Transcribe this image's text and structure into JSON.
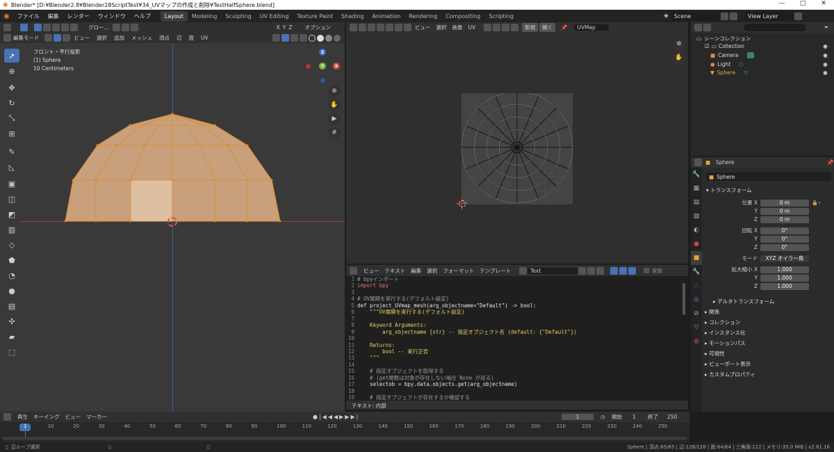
{
  "window": {
    "title": "Blender* [D:¥Blender2.8¥Blender28ScriptTest¥34_UVマップの作成と削除¥TestHalfSphere.blend]",
    "controls": [
      "—",
      "□",
      "✕"
    ]
  },
  "menu": {
    "items": [
      "ファイル",
      "編集",
      "レンダー",
      "ウィンドウ",
      "ヘルプ"
    ],
    "workspaces": [
      "Layout",
      "Modeling",
      "Sculpting",
      "UV Editing",
      "Texture Paint",
      "Shading",
      "Animation",
      "Rendering",
      "Compositing",
      "Scripting"
    ],
    "active_workspace": "Layout",
    "scene": "Scene",
    "view_layer": "View Layer"
  },
  "viewport": {
    "mode": "編集モード",
    "menus": [
      "ビュー",
      "選択",
      "追加",
      "メッシュ",
      "頂点",
      "辺",
      "面",
      "UV"
    ],
    "orientation": "グロー...",
    "options": "オプション",
    "axes": [
      "X",
      "Y",
      "Z"
    ],
    "info_line1": "フロント・平行投影",
    "info_line2": "(1) Sphere",
    "info_line3": "10 Centimeters"
  },
  "uv_editor": {
    "menus": [
      "ビュー",
      "選択",
      "画像",
      "UV"
    ],
    "new_label": "新規",
    "open_label": "開く",
    "uvmap": "UVMap"
  },
  "text_editor": {
    "menus": [
      "ビュー",
      "テキスト",
      "編集",
      "選択",
      "フォーマット",
      "テンプレート"
    ],
    "file": "Text",
    "register": "登録",
    "status": "テキスト: 内部",
    "lines": [
      {
        "n": "1",
        "t": "# bpyインポート",
        "c": "#9a9a9a"
      },
      {
        "n": "2",
        "t": "import bpy",
        "c": "#e07070"
      },
      {
        "n": "3",
        "t": "",
        "c": "#ddd"
      },
      {
        "n": "4",
        "t": "# UV展開を実行する(デフォルト設定)",
        "c": "#9a9a9a"
      },
      {
        "n": "5",
        "t": "def project_UVmap_mesh(arg_objectname=\"Default\") -> bool:",
        "c": "#e6e6e6"
      },
      {
        "n": "6",
        "t": "    \"\"\"UV展開を実行する(デフォルト設定)",
        "c": "#e8d060"
      },
      {
        "n": "7",
        "t": "",
        "c": "#ddd"
      },
      {
        "n": "8",
        "t": "    Keyword Arguments:",
        "c": "#e8d060"
      },
      {
        "n": "9",
        "t": "        arg_objectname {str} -- 指定オブジェクト名 (default: {\"Default\"})",
        "c": "#e8d060"
      },
      {
        "n": "10",
        "t": "",
        "c": "#ddd"
      },
      {
        "n": "11",
        "t": "    Returns:",
        "c": "#e8d060"
      },
      {
        "n": "12",
        "t": "        bool -- 実行正否",
        "c": "#e8d060"
      },
      {
        "n": "13",
        "t": "    \"\"\"",
        "c": "#e8d060"
      },
      {
        "n": "14",
        "t": "",
        "c": "#ddd"
      },
      {
        "n": "15",
        "t": "    # 指定オブジェクトを取得する",
        "c": "#9a9a9a"
      },
      {
        "n": "16",
        "t": "    # (get関数は対象が存在しない場合 None が返る)",
        "c": "#9a9a9a"
      },
      {
        "n": "17",
        "t": "    selectob = bpy.data.objects.get(arg_objectname)",
        "c": "#e6e6e6"
      },
      {
        "n": "18",
        "t": "",
        "c": "#ddd"
      },
      {
        "n": "19",
        "t": "    # 指定オブジェクトが存在するか確認する",
        "c": "#9a9a9a"
      }
    ]
  },
  "outliner": {
    "root": "シーンコレクション",
    "collection": "Collection",
    "items": [
      "Camera",
      "Light",
      "Sphere"
    ]
  },
  "properties": {
    "object": "Sphere",
    "object_field": "Sphere",
    "transform": "トランスフォーム",
    "location_label": "位置 X",
    "rotation_label": "回転 X",
    "scale_label": "拡大縮小 X",
    "y": "Y",
    "z": "Z",
    "loc": [
      "0 m",
      "0 m",
      "0 m"
    ],
    "rot": [
      "0°",
      "0°",
      "0°"
    ],
    "scale": [
      "1.000",
      "1.000",
      "1.000"
    ],
    "mode_label": "モード",
    "mode": "XYZ オイラー角",
    "delta": "デルタトランスフォーム",
    "sections": [
      "関係",
      "コレクション",
      "インスタンス化",
      "モーションパス",
      "可視性",
      "ビューポート表示",
      "カスタムプロパティ"
    ]
  },
  "timeline": {
    "menus": [
      "再生",
      "キーイング",
      "ビュー",
      "マーカー"
    ],
    "current": "1",
    "start_label": "開始",
    "start": "1",
    "end_label": "終了",
    "end": "250",
    "ticks": [
      "1",
      "10",
      "20",
      "30",
      "40",
      "50",
      "60",
      "70",
      "80",
      "90",
      "100",
      "110",
      "120",
      "130",
      "140",
      "150",
      "160",
      "170",
      "180",
      "190",
      "200",
      "210",
      "220",
      "230",
      "240",
      "250"
    ]
  },
  "statusbar": {
    "left": "辺ループ選択",
    "right": "Sphere | 頂点:65/65 | 辺:128/128 | 面:64/64 | 三角面:112 | メモリ:35.0 MiB | v2.81.16"
  }
}
